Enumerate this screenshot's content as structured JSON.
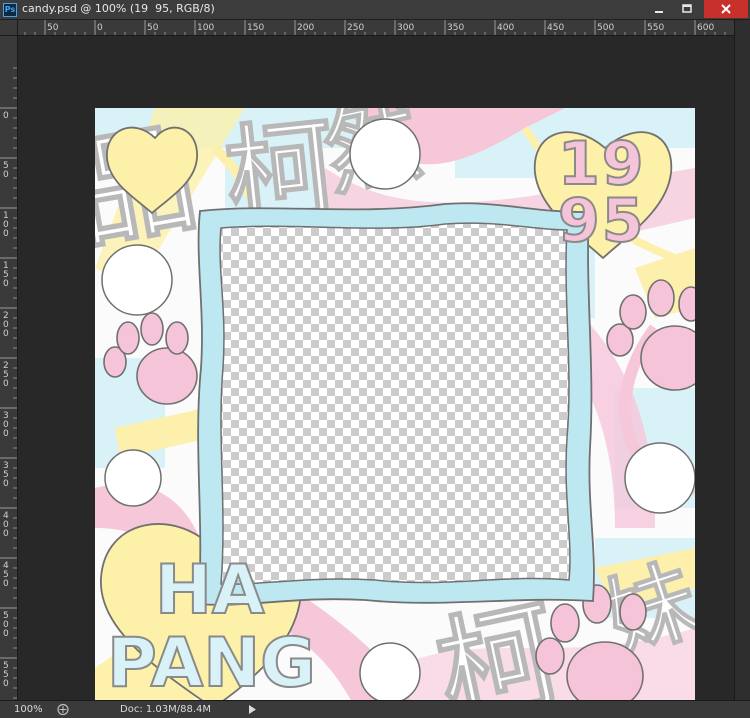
{
  "app": {
    "logo": "Ps",
    "document_title": "candy.psd @ 100% (19  95, RGB/8)",
    "window_controls": [
      "minimize-icon",
      "maximize-icon",
      "close-icon"
    ]
  },
  "rulers": {
    "horizontal": [
      "50",
      "0",
      "50",
      "100",
      "150",
      "200",
      "250",
      "300",
      "350",
      "400",
      "450",
      "500",
      "550",
      "600"
    ],
    "vertical": [
      "0",
      "50",
      "100",
      "150",
      "200",
      "250",
      "300",
      "350",
      "400",
      "450",
      "500",
      "550",
      "600"
    ]
  },
  "artwork": {
    "year_top": "19",
    "year_bottom": "95",
    "ha": "HA",
    "pang": "PANG",
    "glyphs": [
      "品",
      "柯",
      "然",
      "柯",
      "妹"
    ],
    "colors": {
      "pink": "#f6c4d8",
      "yellow": "#fdf0a8",
      "cyan": "#d8f2f8",
      "frame": "#bde7f1",
      "text_outline": "#8a8a8a"
    }
  },
  "status": {
    "zoom": "100%",
    "doc": "Doc: 1.03M/88.4M"
  }
}
